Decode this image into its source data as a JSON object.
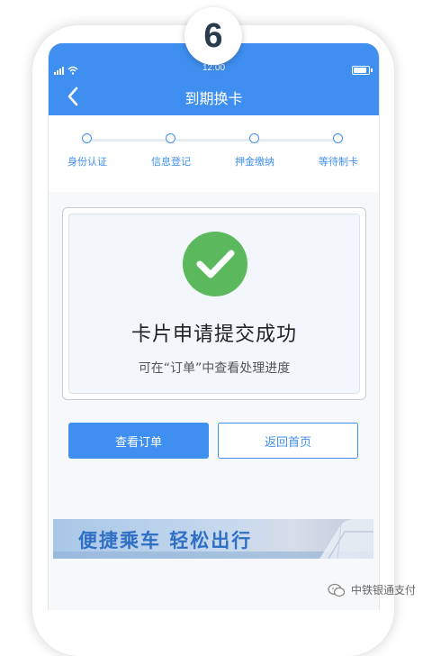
{
  "step_number": "6",
  "status_bar": {
    "time": "12:00"
  },
  "nav": {
    "title": "到期换卡"
  },
  "steps": [
    {
      "label": "身份认证"
    },
    {
      "label": "信息登记"
    },
    {
      "label": "押金缴纳"
    },
    {
      "label": "等待制卡"
    }
  ],
  "result": {
    "title": "卡片申请提交成功",
    "subtitle": "可在“订单”中查看处理进度",
    "icon": "check-circle-icon"
  },
  "buttons": {
    "view_order": "查看订单",
    "back_home": "返回首页"
  },
  "banner": {
    "text": "便捷乘车  轻松出行"
  },
  "watermark": {
    "text": "中铁银通支付"
  },
  "colors": {
    "primary": "#3f8ff1",
    "success": "#5cb85c"
  }
}
